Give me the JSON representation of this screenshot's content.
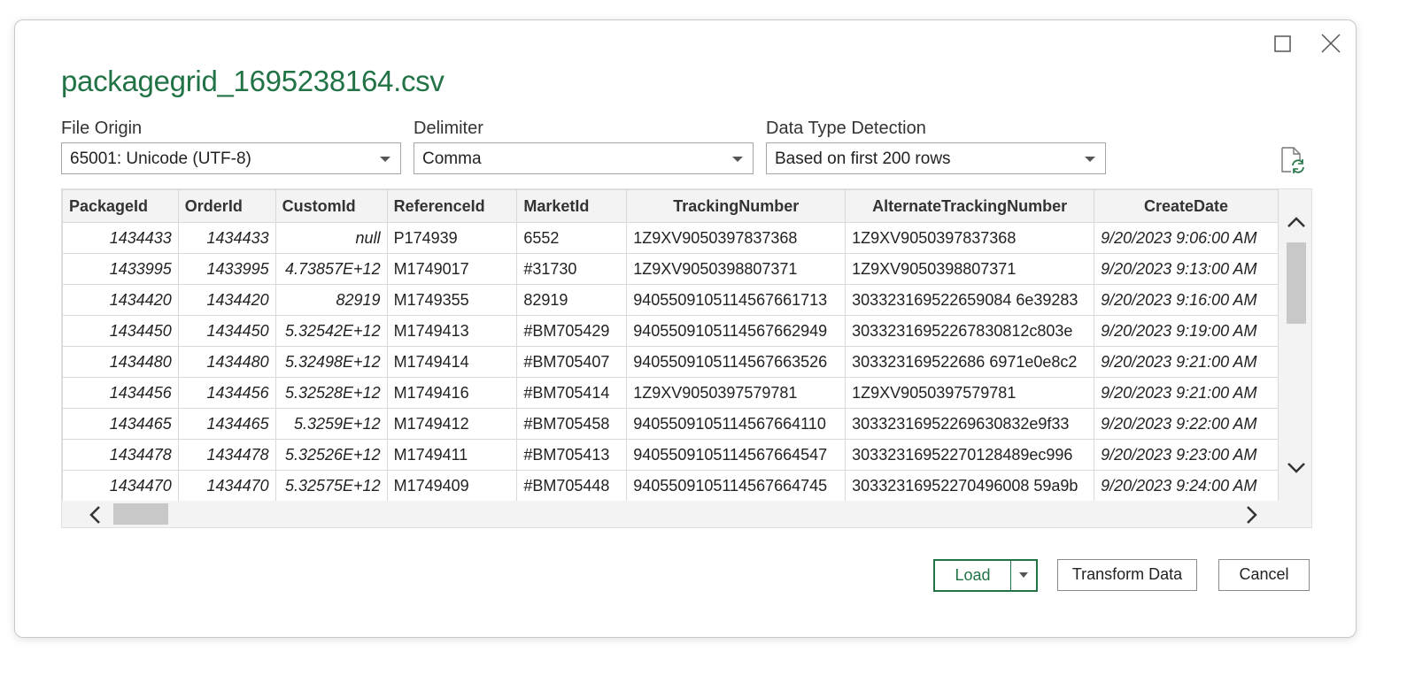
{
  "dialog": {
    "title": "packagegrid_1695238164.csv",
    "maximize_icon": "maximize-icon",
    "close_icon": "close-icon"
  },
  "options": {
    "file_origin": {
      "label": "File Origin",
      "value": "65001: Unicode (UTF-8)"
    },
    "delimiter": {
      "label": "Delimiter",
      "value": "Comma"
    },
    "data_type_detection": {
      "label": "Data Type Detection",
      "value": "Based on first 200 rows"
    },
    "refresh_icon": "refresh-icon"
  },
  "grid": {
    "columns": [
      "PackageId",
      "OrderId",
      "CustomId",
      "ReferenceId",
      "MarketId",
      "TrackingNumber",
      "AlternateTrackingNumber",
      "CreateDate"
    ],
    "rows": [
      [
        "1434433",
        "1434433",
        "null",
        "P174939",
        "6552",
        "1Z9XV9050397837368",
        "1Z9XV9050397837368",
        "9/20/2023 9:06:00 AM"
      ],
      [
        "1433995",
        "1433995",
        "4.73857E+12",
        "M1749017",
        "#31730",
        "1Z9XV9050398807371",
        "1Z9XV9050398807371",
        "9/20/2023 9:13:00 AM"
      ],
      [
        "1434420",
        "1434420",
        "82919",
        "M1749355",
        "82919",
        "9405509105114567661713",
        "303323169522659084 6e39283",
        "9/20/2023 9:16:00 AM"
      ],
      [
        "1434450",
        "1434450",
        "5.32542E+12",
        "M1749413",
        "#BM705429",
        "9405509105114567662949",
        "30332316952267830812c803e",
        "9/20/2023 9:19:00 AM"
      ],
      [
        "1434480",
        "1434480",
        "5.32498E+12",
        "M1749414",
        "#BM705407",
        "9405509105114567663526",
        "303323169522686 6971e0e8c2",
        "9/20/2023 9:21:00 AM"
      ],
      [
        "1434456",
        "1434456",
        "5.32528E+12",
        "M1749416",
        "#BM705414",
        "1Z9XV9050397579781",
        "1Z9XV9050397579781",
        "9/20/2023 9:21:00 AM"
      ],
      [
        "1434465",
        "1434465",
        "5.3259E+12",
        "M1749412",
        "#BM705458",
        "9405509105114567664110",
        "30332316952269630832e9f33",
        "9/20/2023 9:22:00 AM"
      ],
      [
        "1434478",
        "1434478",
        "5.32526E+12",
        "M1749411",
        "#BM705413",
        "9405509105114567664547",
        "30332316952270128489ec996",
        "9/20/2023 9:23:00 AM"
      ],
      [
        "1434470",
        "1434470",
        "5.32575E+12",
        "M1749409",
        "#BM705448",
        "9405509105114567664745",
        "30332316952270496008 59a9b",
        "9/20/2023 9:24:00 AM"
      ]
    ]
  },
  "buttons": {
    "load": "Load",
    "transform": "Transform Data",
    "cancel": "Cancel"
  }
}
